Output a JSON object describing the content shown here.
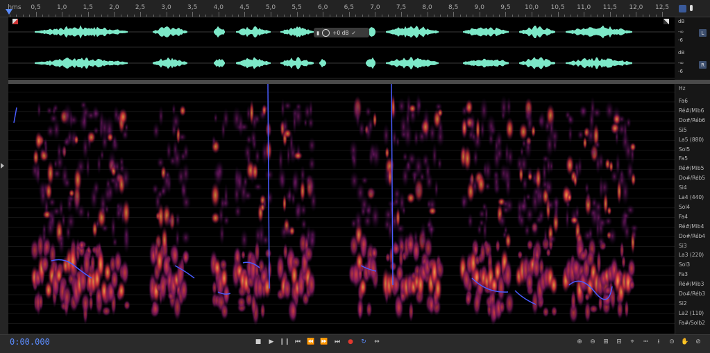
{
  "ruler": {
    "unit_label": "hms",
    "ticks": [
      "0,5",
      "1,0",
      "1,5",
      "2,0",
      "2,5",
      "3,0",
      "3,5",
      "4,0",
      "4,5",
      "5,0",
      "5,5",
      "6,0",
      "6,5",
      "7,0",
      "7,5",
      "8,0",
      "8,5",
      "9,0",
      "9,5",
      "10,0",
      "10,5",
      "11,0",
      "11,5",
      "12,0",
      "12,5"
    ]
  },
  "waveform": {
    "channels": [
      {
        "db_unit": "dB",
        "db_minus": "-∞",
        "db_level": "-6",
        "channel_label": "L"
      },
      {
        "db_unit": "dB",
        "db_minus": "-∞",
        "db_level": "-6",
        "channel_label": "R"
      }
    ],
    "hud_gain": "+0 dB",
    "color": "#7de8c8"
  },
  "spectral": {
    "axis_unit": "Hz",
    "note_labels": [
      "Fa6",
      "Ré#/Mib6",
      "Do#/Réb6",
      "Si5",
      "La5 (880)",
      "Sol5",
      "Fa5",
      "Ré#/Mib5",
      "Do#/Réb5",
      "Si4",
      "La4 (440)",
      "Sol4",
      "Fa4",
      "Ré#/Mib4",
      "Do#/Réb4",
      "Si3",
      "La3 (220)",
      "Sol3",
      "Fa3",
      "Ré#/Mib3",
      "Do#/Réb3",
      "Si2",
      "La2 (110)",
      "Fa#/Solb2"
    ],
    "pitch_color": "#4a5cff"
  },
  "transport": {
    "time": "0:00.000",
    "buttons": [
      {
        "name": "stop-button",
        "glyph": "■"
      },
      {
        "name": "play-button",
        "glyph": "▶"
      },
      {
        "name": "pause-button",
        "glyph": "❙❙"
      },
      {
        "name": "go-to-start-button",
        "glyph": "⏮"
      },
      {
        "name": "rewind-button",
        "glyph": "⏪"
      },
      {
        "name": "fast-forward-button",
        "glyph": "⏩"
      },
      {
        "name": "go-to-end-button",
        "glyph": "⏭"
      },
      {
        "name": "record-button",
        "glyph": "●"
      },
      {
        "name": "loop-playback-button",
        "glyph": "↻"
      },
      {
        "name": "skip-selection-button",
        "glyph": "⇔"
      }
    ]
  },
  "zoom": {
    "buttons": [
      {
        "name": "zoom-in-amplitude-button",
        "glyph": "⊕"
      },
      {
        "name": "zoom-out-amplitude-button",
        "glyph": "⊖"
      },
      {
        "name": "zoom-in-time-button",
        "glyph": "⊞"
      },
      {
        "name": "zoom-out-time-button",
        "glyph": "⊟"
      },
      {
        "name": "zoom-to-selection-button",
        "glyph": "⌖"
      },
      {
        "name": "zoom-in-left-button",
        "glyph": "⭲"
      },
      {
        "name": "zoom-in-right-button",
        "glyph": "⭳"
      },
      {
        "name": "zoom-out-full-button",
        "glyph": "⊙"
      },
      {
        "name": "hand-tool-button",
        "glyph": "✋"
      },
      {
        "name": "zoom-reset-button",
        "glyph": "⊘"
      }
    ]
  }
}
